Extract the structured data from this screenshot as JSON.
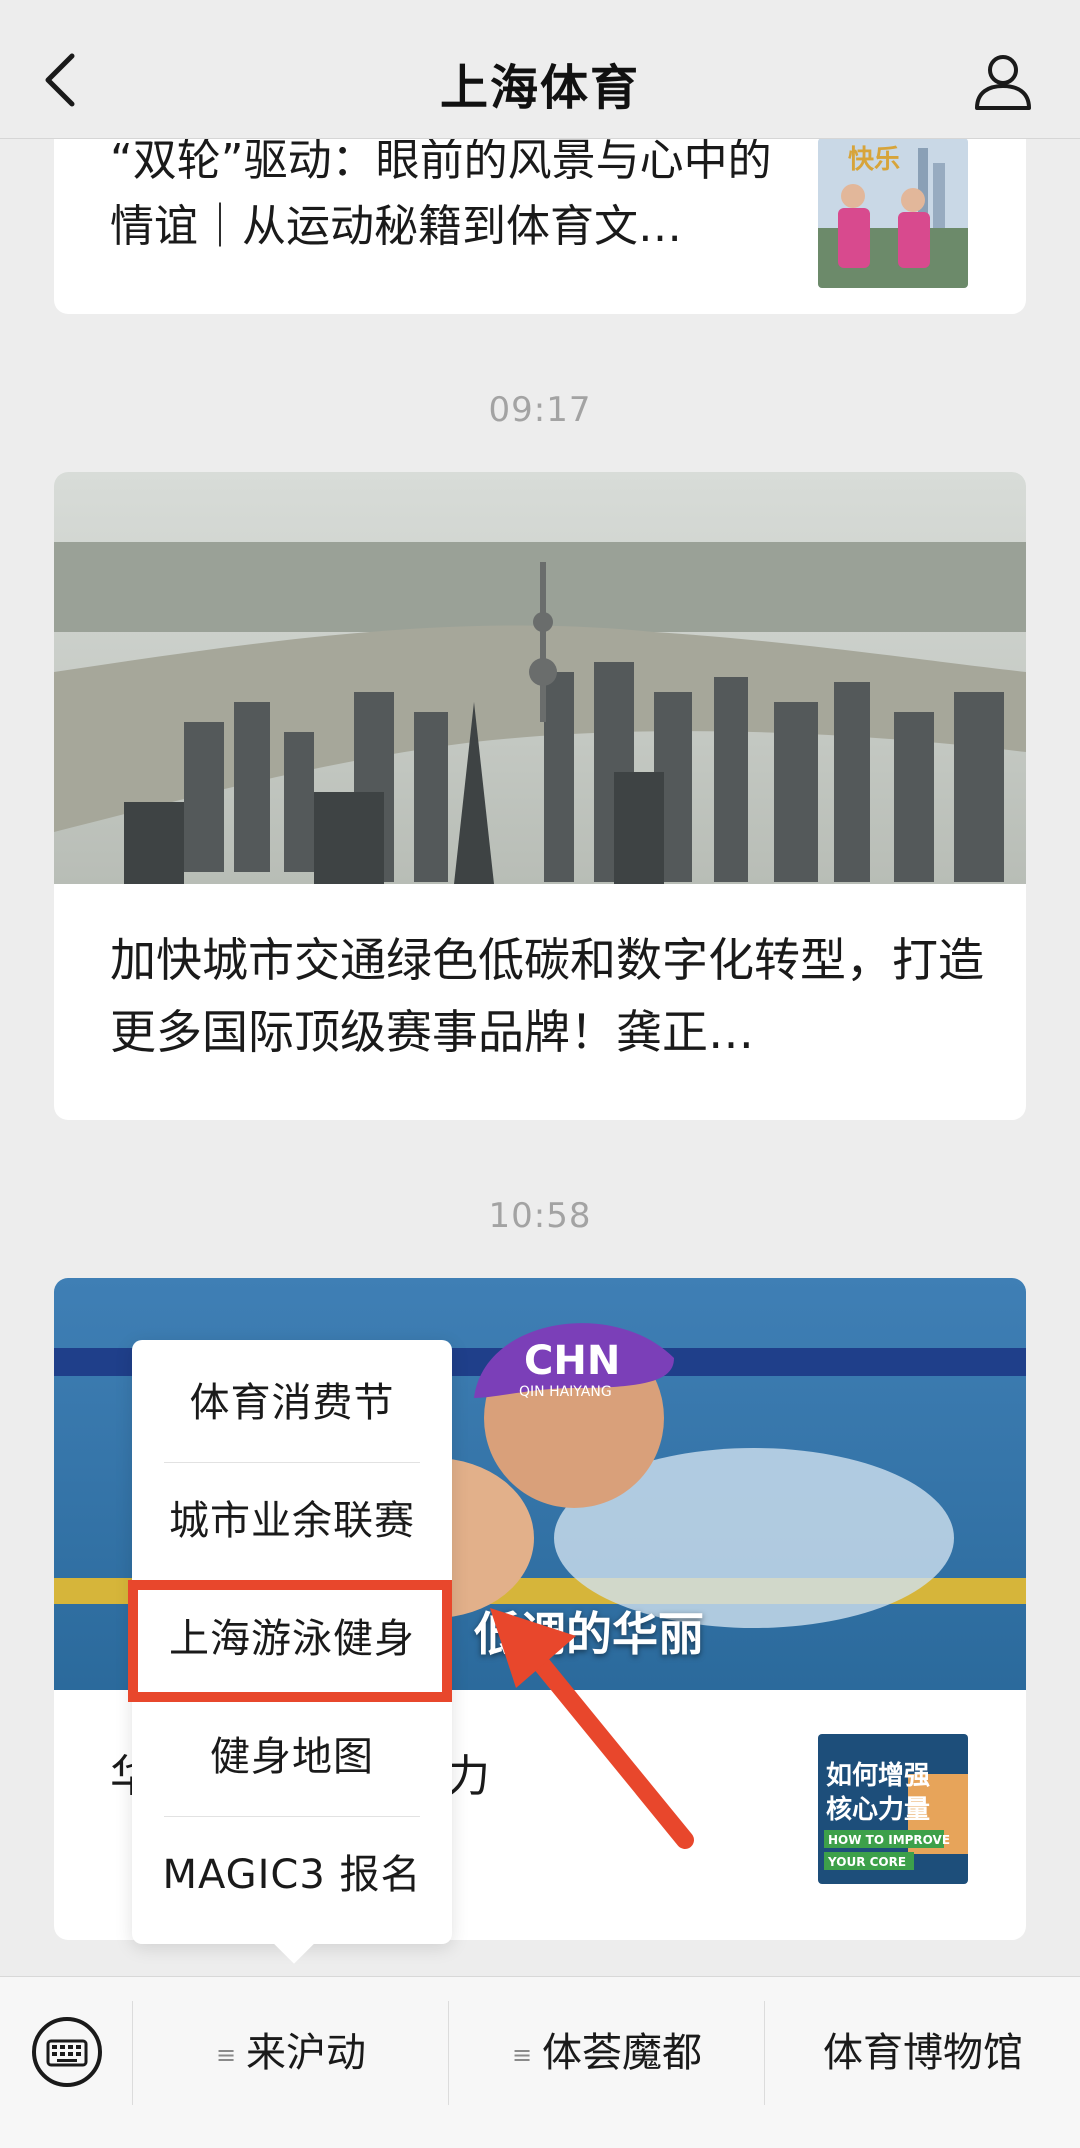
{
  "header": {
    "title": "上海体育",
    "back_icon": "chevron-left-icon",
    "profile_icon": "person-icon"
  },
  "feed": {
    "card1": {
      "title": "“双轮”驱动：眼前的风景与心中的情谊｜从运动秘籍到体育文…",
      "thumb_text": "快乐"
    },
    "time1": "09:17",
    "card2": {
      "title": "加快城市交通绿色低碳和数字化转型，打造更多国际顶级赛事品牌！龚正…"
    },
    "time2": "10:58",
    "card3": {
      "overlay_title": "低调的华丽",
      "cap_text": "CHN",
      "cap_name": "QIN HAIYANG",
      "title_visible": "华 如何增强核心 力",
      "thumb_text_1": "如何增强",
      "thumb_text_2": "核心力量",
      "thumb_text_3": "HOW TO IMPROVE",
      "thumb_text_4": "YOUR CORE"
    }
  },
  "popup_menu": {
    "items": [
      "体育消费节",
      "城市业余联赛",
      "上海游泳健身",
      "健身地图",
      "MAGIC3 报名"
    ],
    "highlighted_index": 2
  },
  "bottom_menu": {
    "keyboard_icon": "keyboard-icon",
    "items": [
      {
        "label": "来沪动",
        "has_submenu": true
      },
      {
        "label": "体荟魔都",
        "has_submenu": true
      },
      {
        "label": "体育博物馆",
        "has_submenu": false
      }
    ],
    "submenu_glyph": "≡"
  },
  "colors": {
    "background": "#ededed",
    "highlight": "#e8472c",
    "time_text": "#a3a3a3"
  }
}
